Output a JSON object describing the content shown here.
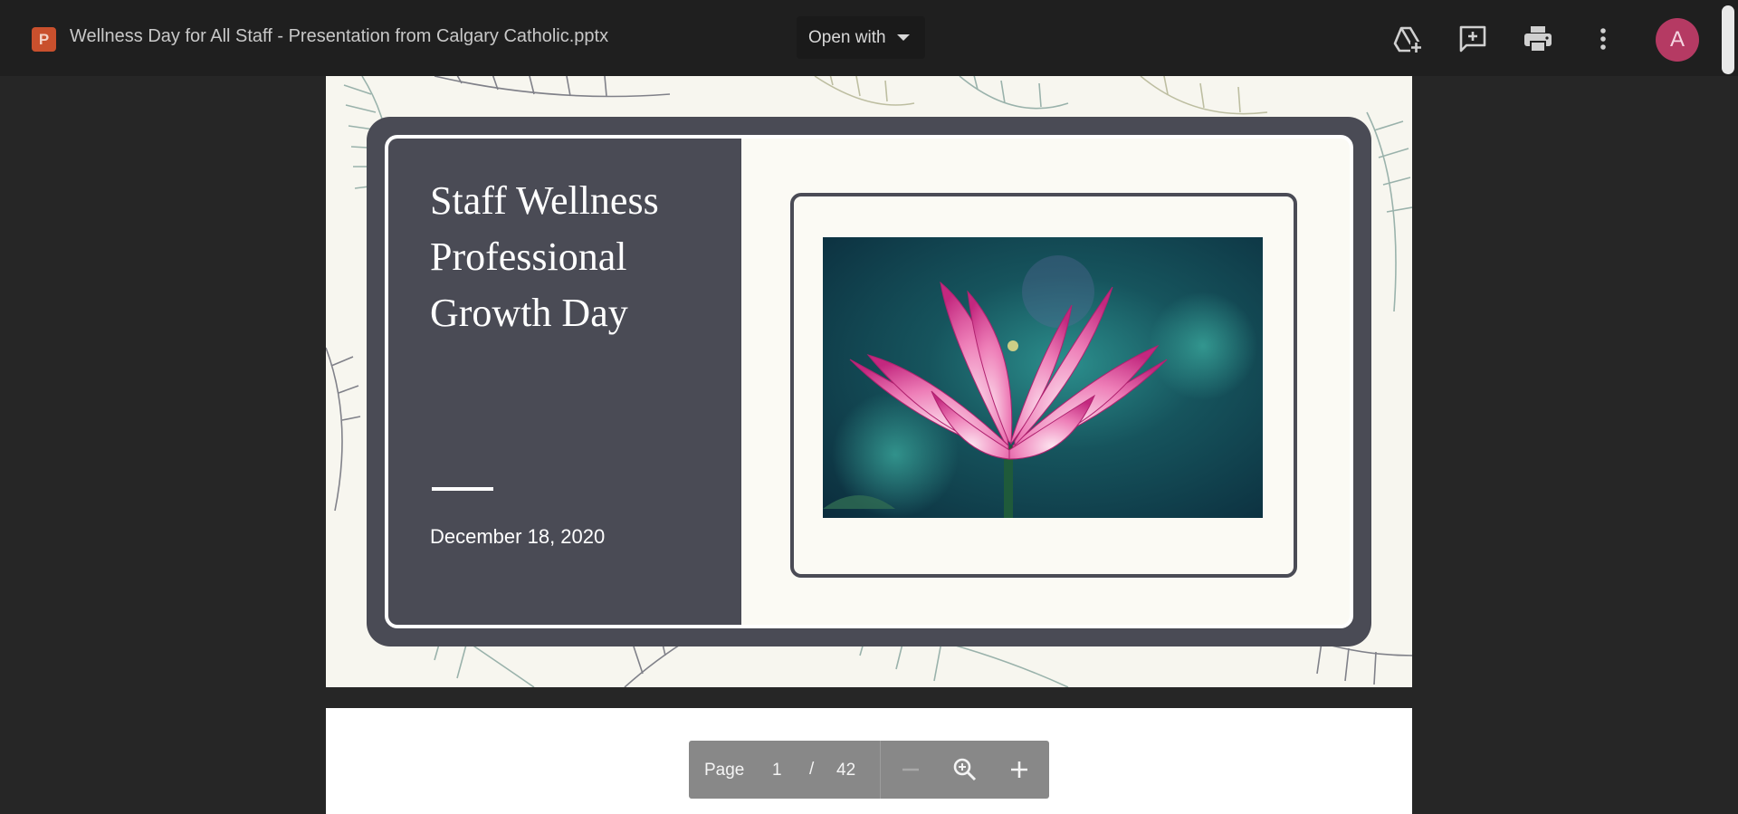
{
  "topbar": {
    "file_type_badge": "P",
    "file_name": "Wellness Day for All Staff - Presentation from Calgary Catholic.pptx",
    "open_with_label": "Open with",
    "avatar_letter": "A",
    "icons": [
      "add-to-drive-icon",
      "add-comment-icon",
      "print-icon",
      "more-vert-icon"
    ]
  },
  "slide": {
    "title_lines": [
      "Staff Wellness",
      "Professional",
      "Growth Day"
    ],
    "date": "December 18, 2020",
    "image": "lotus-flower-photo"
  },
  "page_controls": {
    "page_label": "Page",
    "current_page": "1",
    "separator": "/",
    "total_pages": "42",
    "icons": [
      "zoom-out-icon",
      "zoom-fit-icon",
      "zoom-in-icon"
    ]
  },
  "colors": {
    "topbar_bg": "#1f1f1f",
    "viewer_bg": "#262626",
    "slide_panel": "#4a4b55",
    "avatar": "#b53a63",
    "file_badge": "#c9502d",
    "controls_bg": "#888888"
  }
}
